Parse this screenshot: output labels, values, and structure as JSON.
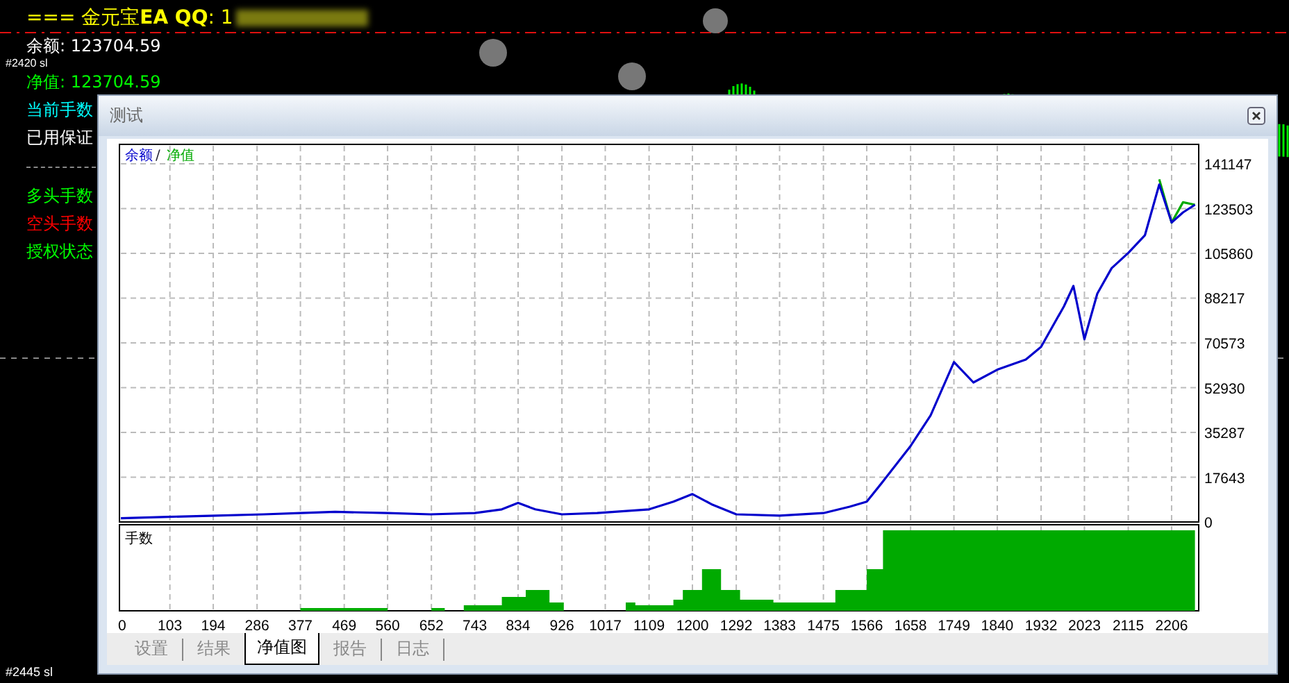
{
  "chart_labels": {
    "top_ticket": "#2420 sl",
    "bottom_ticket": "#2445 sl"
  },
  "info_panel": {
    "heading": "=== 金元宝**EA QQ**: 1",
    "lines": [
      {
        "kind": "text",
        "text": "余额: 123704.59",
        "color": "#ffffff"
      },
      {
        "kind": "text",
        "text": "净值: 123704.59",
        "color": "#00ff00"
      },
      {
        "kind": "text",
        "text": "当前手数",
        "color": "#00ffff"
      },
      {
        "kind": "text",
        "text": "已用保证",
        "color": "#ffffff"
      },
      {
        "kind": "rule"
      },
      {
        "kind": "text",
        "text": "多头手数",
        "color": "#00ff00"
      },
      {
        "kind": "text",
        "text": "空头手数",
        "color": "#ff0000"
      },
      {
        "kind": "text",
        "text": "授权状态",
        "color": "#00ff00"
      }
    ]
  },
  "window": {
    "title": "测试",
    "chart": {
      "legend_separator": "/",
      "lots_label": "手数",
      "chart_data": {
        "type": "line",
        "grid": true,
        "x": [
          0,
          100,
          200,
          300,
          377,
          450,
          560,
          650,
          743,
          800,
          834,
          870,
          926,
          1000,
          1109,
          1160,
          1200,
          1240,
          1292,
          1383,
          1475,
          1530,
          1566,
          1600,
          1658,
          1700,
          1749,
          1790,
          1840,
          1900,
          1932,
          1980,
          2000,
          2023,
          2050,
          2080,
          2115,
          2150,
          2180,
          2206,
          2230,
          2255
        ],
        "series": [
          {
            "name": "余额",
            "color": "#0000cc",
            "values": [
              1500,
              2000,
              2500,
              3000,
              3500,
              4000,
              3500,
              3000,
              3500,
              5000,
              7500,
              5000,
              3000,
              3500,
              5000,
              8000,
              11000,
              7000,
              3000,
              2500,
              3500,
              6000,
              8000,
              16000,
              30000,
              42000,
              63000,
              55000,
              60000,
              64000,
              69000,
              85000,
              93000,
              72000,
              90000,
              100000,
              106000,
              113000,
              133000,
              118000,
              122000,
              125000
            ]
          },
          {
            "name": "净值",
            "color": "#00aa00",
            "values": [
              null,
              null,
              null,
              null,
              null,
              null,
              null,
              null,
              null,
              null,
              null,
              null,
              null,
              null,
              null,
              null,
              null,
              null,
              null,
              null,
              null,
              null,
              null,
              null,
              null,
              null,
              null,
              null,
              null,
              null,
              null,
              null,
              null,
              null,
              null,
              null,
              null,
              null,
              135000,
              118000,
              126000,
              125000
            ]
          }
        ],
        "xlim": [
          0,
          2260
        ],
        "ylim": [
          0,
          141147
        ],
        "xticks": [
          0,
          103,
          194,
          286,
          377,
          469,
          560,
          652,
          743,
          834,
          926,
          1017,
          1109,
          1200,
          1292,
          1383,
          1475,
          1566,
          1658,
          1749,
          1840,
          1932,
          2023,
          2115,
          2206
        ],
        "yticks": [
          0,
          17643,
          35287,
          52930,
          70573,
          88217,
          105860,
          123503,
          141147
        ]
      }
    },
    "tabs": [
      {
        "label": "设置",
        "selected": false
      },
      {
        "label": "结果",
        "selected": false
      },
      {
        "label": "净值图",
        "selected": true
      },
      {
        "label": "报告",
        "selected": false
      },
      {
        "label": "日志",
        "selected": false
      }
    ]
  }
}
